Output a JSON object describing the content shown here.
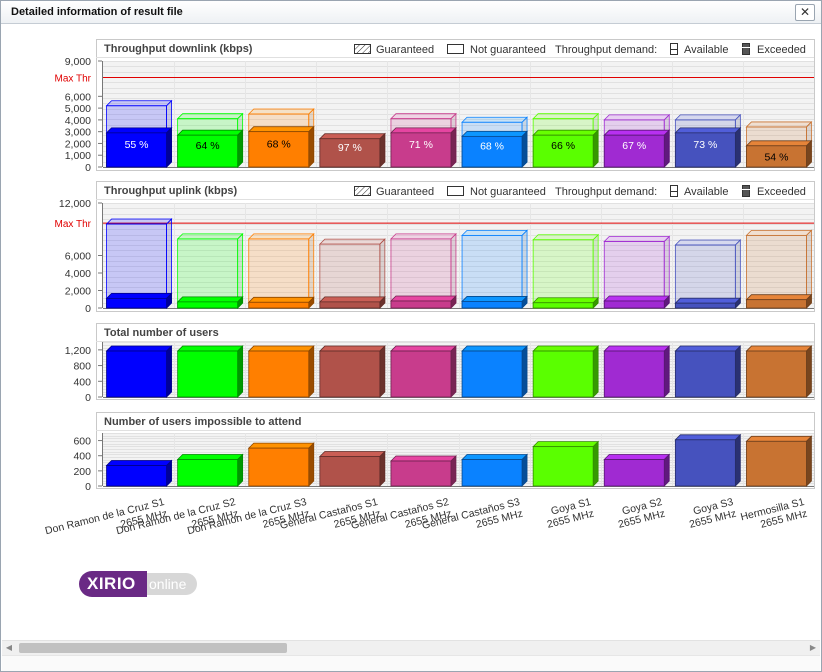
{
  "window": {
    "title": "Detailed information of result file",
    "close_label": "✕"
  },
  "legend": {
    "guaranteed": "Guaranteed",
    "not_guaranteed": "Not guaranteed",
    "demand": "Throughput demand:",
    "available": "Available",
    "exceeded": "Exceeded"
  },
  "colors": [
    "#0000ff",
    "#00ff00",
    "#ff7f00",
    "#b0524a",
    "#c83c8c",
    "#0a82ff",
    "#5aff00",
    "#a02ad2",
    "#4652be",
    "#c87332"
  ],
  "logo": {
    "main": "XIRIO",
    "sub": "online"
  },
  "chart_data": [
    {
      "type": "bar",
      "title": "Throughput downlink (kbps)",
      "categories": [
        "Don Ramon de la Cruz S1 2655 MHz",
        "Don Ramon de la Cruz S2 2655 MHz",
        "Don Ramon de la Cruz S3 2655 MHz",
        "General Castaños S1 2655 MHz",
        "General Castaños S2 2655 MHz",
        "General Castaños S3 2655 MHz",
        "Goya S1 2655 MHz",
        "Goya S2 2655 MHz",
        "Goya S3 2655 MHz",
        "Hermosilla S1 2655 MHz"
      ],
      "series": [
        {
          "name": "Guaranteed",
          "values": [
            2900,
            2700,
            3000,
            2400,
            2900,
            2600,
            2700,
            2700,
            2900,
            1800
          ]
        },
        {
          "name": "Not guaranteed",
          "values": [
            5200,
            4100,
            4500,
            2400,
            4100,
            3800,
            4100,
            4000,
            4000,
            3400
          ]
        }
      ],
      "data_labels": [
        "55 %",
        "64 %",
        "68 %",
        "97 %",
        "71 %",
        "68 %",
        "66 %",
        "67 %",
        "73 %",
        "54 %"
      ],
      "max_thr": {
        "label": "Max Thr",
        "value": 7600
      },
      "yticks": [
        "0",
        "1,000",
        "2,000",
        "3,000",
        "4,000",
        "5,000",
        "6,000",
        "9,000"
      ],
      "ylim": [
        0,
        9000
      ]
    },
    {
      "type": "bar",
      "title": "Throughput uplink (kbps)",
      "categories": [
        "Don Ramon de la Cruz S1 2655 MHz",
        "Don Ramon de la Cruz S2 2655 MHz",
        "Don Ramon de la Cruz S3 2655 MHz",
        "General Castaños S1 2655 MHz",
        "General Castaños S2 2655 MHz",
        "General Castaños S3 2655 MHz",
        "Goya S1 2655 MHz",
        "Goya S2 2655 MHz",
        "Goya S3 2655 MHz",
        "Hermosilla S1 2655 MHz"
      ],
      "series": [
        {
          "name": "Guaranteed",
          "values": [
            1100,
            700,
            650,
            700,
            800,
            750,
            600,
            800,
            550,
            950
          ]
        },
        {
          "name": "Not guaranteed",
          "values": [
            9600,
            7900,
            7900,
            7300,
            7900,
            8300,
            7800,
            7600,
            7200,
            8300
          ]
        }
      ],
      "max_thr": {
        "label": "Max Thr",
        "value": 9700
      },
      "yticks": [
        "0",
        "2,000",
        "4,000",
        "6,000",
        "12,000"
      ],
      "ylim": [
        0,
        12000
      ]
    },
    {
      "type": "bar",
      "title": "Total number of users",
      "categories": [
        "Don Ramon de la Cruz S1 2655 MHz",
        "Don Ramon de la Cruz S2 2655 MHz",
        "Don Ramon de la Cruz S3 2655 MHz",
        "General Castaños S1 2655 MHz",
        "General Castaños S2 2655 MHz",
        "General Castaños S3 2655 MHz",
        "Goya S1 2655 MHz",
        "Goya S2 2655 MHz",
        "Goya S3 2655 MHz",
        "Hermosilla S1 2655 MHz"
      ],
      "values": [
        1170,
        1170,
        1170,
        1170,
        1170,
        1170,
        1170,
        1170,
        1170,
        1170
      ],
      "yticks": [
        "0",
        "400",
        "800",
        "1,200"
      ],
      "ylim": [
        0,
        1400
      ]
    },
    {
      "type": "bar",
      "title": "Number of users impossible to attend",
      "categories": [
        "Don Ramon de la Cruz S1 2655 MHz",
        "Don Ramon de la Cruz S2 2655 MHz",
        "Don Ramon de la Cruz S3 2655 MHz",
        "General Castaños S1 2655 MHz",
        "General Castaños S2 2655 MHz",
        "General Castaños S3 2655 MHz",
        "Goya S1 2655 MHz",
        "Goya S2 2655 MHz",
        "Goya S3 2655 MHz",
        "Hermosilla S1 2655 MHz"
      ],
      "values": [
        270,
        350,
        500,
        390,
        330,
        350,
        520,
        350,
        610,
        590
      ],
      "yticks": [
        "0",
        "200",
        "400",
        "600"
      ],
      "ylim": [
        0,
        700
      ]
    }
  ],
  "xlabels": [
    [
      "Don Ramon de la Cruz S1",
      "2655 MHz"
    ],
    [
      "Don Ramon de la Cruz S2",
      "2655 MHz"
    ],
    [
      "Don Ramon de la Cruz S3",
      "2655 MHz"
    ],
    [
      "General Castaños S1",
      "2655 MHz"
    ],
    [
      "General Castaños S2",
      "2655 MHz"
    ],
    [
      "General Castaños S3",
      "2655 MHz"
    ],
    [
      "Goya S1",
      "2655 MHz"
    ],
    [
      "Goya S2",
      "2655 MHz"
    ],
    [
      "Goya S3",
      "2655 MHz"
    ],
    [
      "Hermosilla S1",
      "2655 MHz"
    ]
  ]
}
